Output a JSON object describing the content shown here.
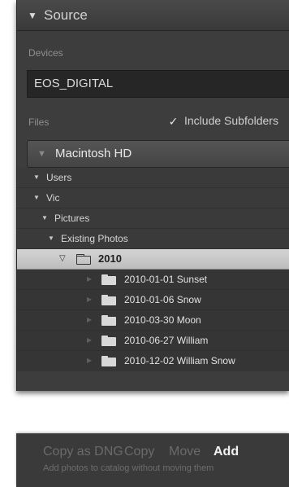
{
  "source": {
    "title": "Source",
    "devices_label": "Devices",
    "device_name": "EOS_DIGITAL",
    "files_label": "Files",
    "include_subfolders_label": "Include Subfolders",
    "include_subfolders_checked": true,
    "volume": "Macintosh HD",
    "tree": [
      {
        "label": "Users",
        "type": "expanded"
      },
      {
        "label": "Vic",
        "type": "expanded"
      },
      {
        "label": "Pictures",
        "type": "expanded"
      },
      {
        "label": "Existing Photos",
        "type": "expanded"
      },
      {
        "label": "2010",
        "type": "selected"
      },
      {
        "label": "2010-01-01 Sunset",
        "type": "subfolder"
      },
      {
        "label": "2010-01-06 Snow",
        "type": "subfolder"
      },
      {
        "label": "2010-03-30 Moon",
        "type": "subfolder"
      },
      {
        "label": "2010-06-27 William",
        "type": "subfolder"
      },
      {
        "label": "2010-12-02 William Snow",
        "type": "subfolder"
      }
    ]
  },
  "import_modes": {
    "copy_as_dng": "Copy as DNG",
    "copy": "Copy",
    "move": "Move",
    "add": "Add",
    "active": "Add",
    "description": "Add photos to catalog without moving them"
  },
  "colors": {
    "panel_bg": "#3d3d3d",
    "selected_row_bg": "#c9c9c9",
    "active_text": "#f2f2f2",
    "inactive_text": "#6a6a6a"
  }
}
